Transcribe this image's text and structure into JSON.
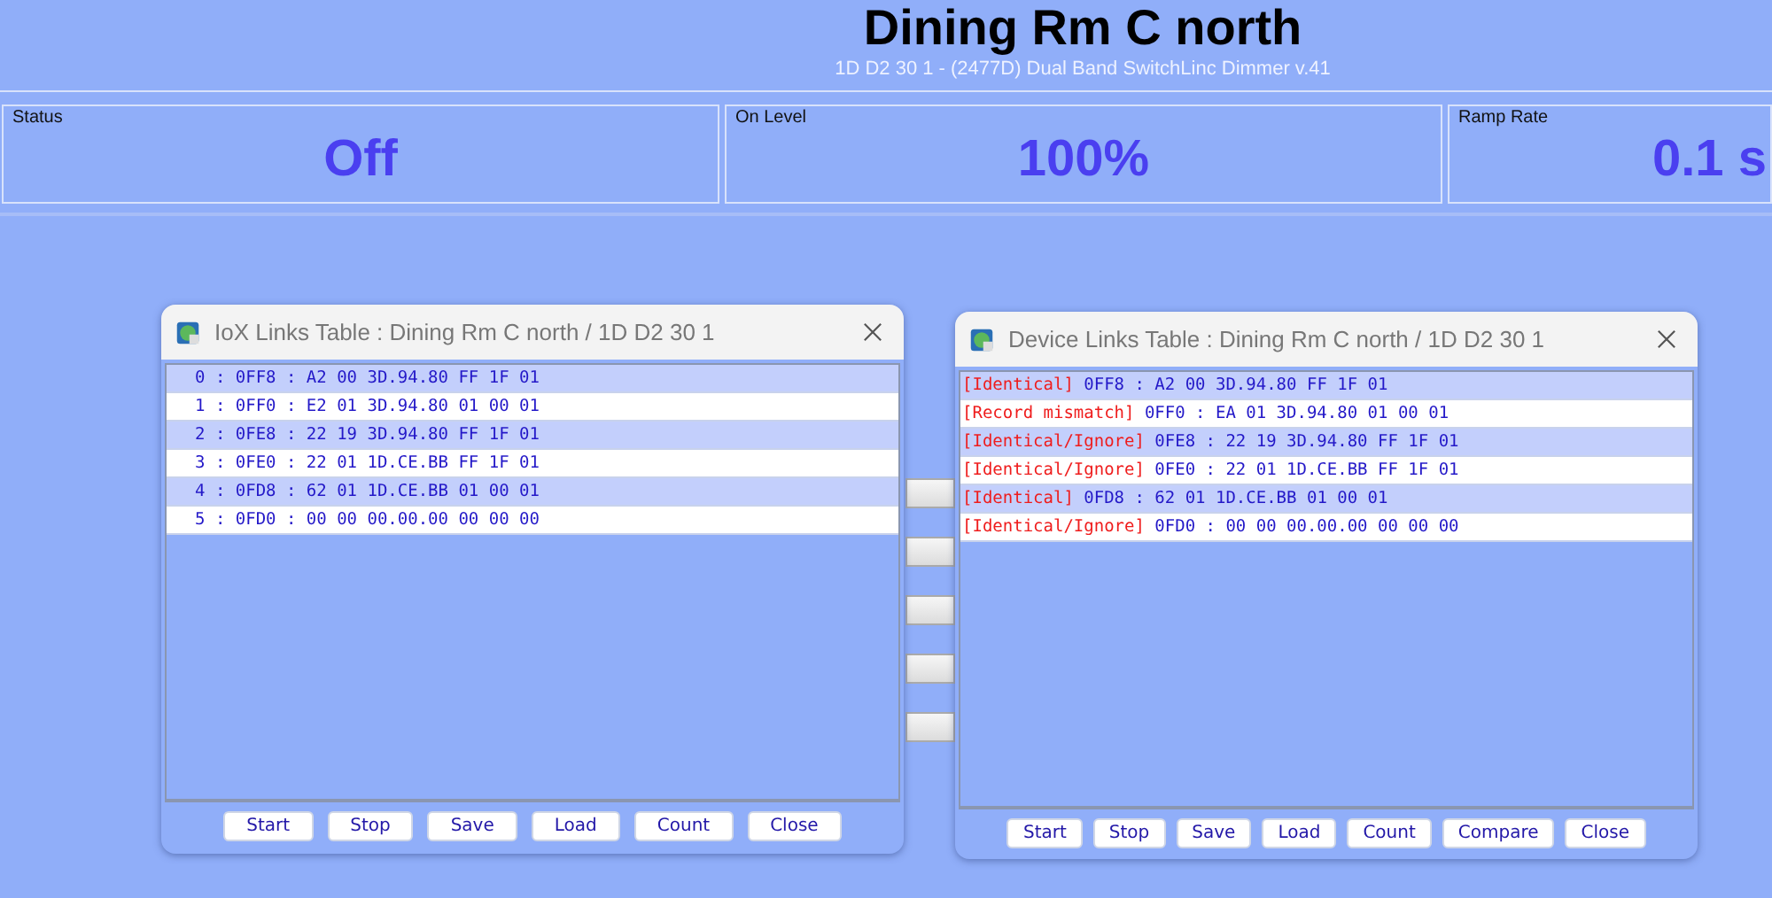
{
  "header": {
    "title": "Dining Rm C north",
    "subtitle": "1D D2 30 1 - (2477D) Dual Band SwitchLinc Dimmer v.41"
  },
  "panels": [
    {
      "label": "Status",
      "value": "Off"
    },
    {
      "label": "On Level",
      "value": "100%"
    },
    {
      "label": "Ramp Rate",
      "value": "0.1 s"
    }
  ],
  "iox_window": {
    "title": "IoX Links Table : Dining Rm C north / 1D D2 30 1",
    "rows": [
      "0 : 0FF8 : A2 00 3D.94.80 FF 1F 01",
      "1 : 0FF0 : E2 01 3D.94.80 01 00 01",
      "2 : 0FE8 : 22 19 3D.94.80 FF 1F 01",
      "3 : 0FE0 : 22 01 1D.CE.BB FF 1F 01",
      "4 : 0FD8 : 62 01 1D.CE.BB 01 00 01",
      "5 : 0FD0 : 00 00 00.00.00 00 00 00"
    ],
    "buttons": [
      "Start",
      "Stop",
      "Save",
      "Load",
      "Count",
      "Close"
    ]
  },
  "device_window": {
    "title": "Device Links Table : Dining Rm C north / 1D D2 30 1",
    "rows": [
      {
        "status": "[Identical]",
        "text": "0FF8 : A2 00 3D.94.80 FF 1F 01"
      },
      {
        "status": "[Record mismatch]",
        "text": "0FF0 : EA 01 3D.94.80 01 00 01"
      },
      {
        "status": "[Identical/Ignore]",
        "text": "0FE8 : 22 19 3D.94.80 FF 1F 01"
      },
      {
        "status": "[Identical/Ignore]",
        "text": "0FE0 : 22 01 1D.CE.BB FF 1F 01"
      },
      {
        "status": "[Identical]",
        "text": "0FD8 : 62 01 1D.CE.BB 01 00 01"
      },
      {
        "status": "[Identical/Ignore]",
        "text": "0FD0 : 00 00 00.00.00 00 00 00"
      }
    ],
    "buttons": [
      "Start",
      "Stop",
      "Save",
      "Load",
      "Count",
      "Compare",
      "Close"
    ]
  }
}
